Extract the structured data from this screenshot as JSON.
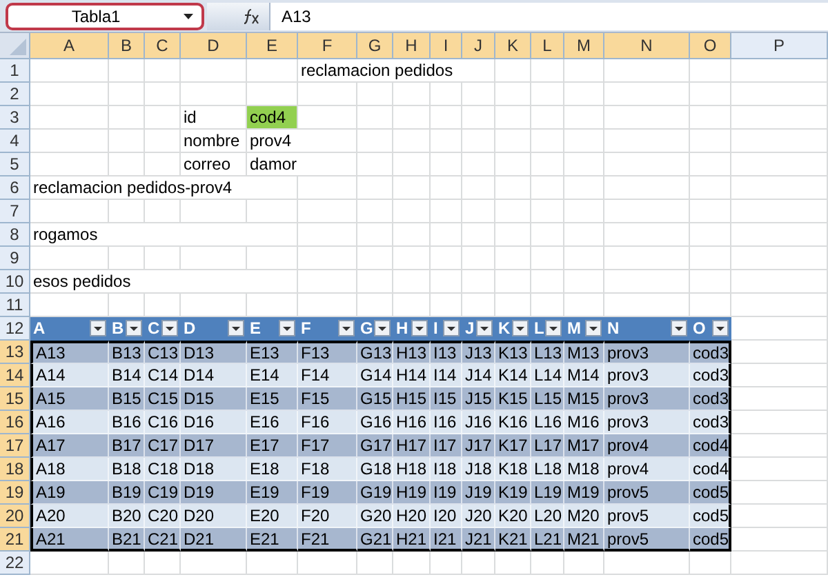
{
  "name_box": {
    "value": "Tabla1"
  },
  "formula_bar": {
    "value": "A13"
  },
  "columns": [
    {
      "label": "A",
      "selected": true
    },
    {
      "label": "B",
      "selected": true
    },
    {
      "label": "C",
      "selected": true
    },
    {
      "label": "D",
      "selected": true
    },
    {
      "label": "E",
      "selected": true
    },
    {
      "label": "F",
      "selected": true
    },
    {
      "label": "G",
      "selected": true
    },
    {
      "label": "H",
      "selected": true
    },
    {
      "label": "I",
      "selected": true
    },
    {
      "label": "J",
      "selected": true
    },
    {
      "label": "K",
      "selected": true
    },
    {
      "label": "L",
      "selected": true
    },
    {
      "label": "M",
      "selected": true
    },
    {
      "label": "N",
      "selected": true
    },
    {
      "label": "O",
      "selected": true
    },
    {
      "label": "P",
      "selected": false
    }
  ],
  "rows": [
    {
      "number": "1",
      "selected": false,
      "kind": "plain",
      "cells": {
        "F": "reclamacion pedidos"
      }
    },
    {
      "number": "2",
      "selected": false,
      "kind": "plain",
      "cells": {}
    },
    {
      "number": "3",
      "selected": false,
      "kind": "plain",
      "cells": {
        "D": "id",
        "E": {
          "text": "cod4",
          "highlighted": true
        }
      }
    },
    {
      "number": "4",
      "selected": false,
      "kind": "plain",
      "cells": {
        "D": "nombre",
        "E": "prov4"
      }
    },
    {
      "number": "5",
      "selected": false,
      "kind": "plain",
      "cells": {
        "D": "correo",
        "E": "damor"
      }
    },
    {
      "number": "6",
      "selected": false,
      "kind": "plain",
      "cells": {
        "A": "reclamacion pedidos-prov4"
      }
    },
    {
      "number": "7",
      "selected": false,
      "kind": "plain",
      "cells": {}
    },
    {
      "number": "8",
      "selected": false,
      "kind": "plain",
      "cells": {
        "A": "rogamos"
      }
    },
    {
      "number": "9",
      "selected": false,
      "kind": "plain",
      "cells": {}
    },
    {
      "number": "10",
      "selected": false,
      "kind": "plain",
      "cells": {
        "A": "esos pedidos"
      }
    },
    {
      "number": "11",
      "selected": false,
      "kind": "plain",
      "cells": {}
    },
    {
      "number": "12",
      "selected": false,
      "kind": "table_header",
      "cells": {
        "A": "A",
        "B": "B",
        "C": "C",
        "D": "D",
        "E": "E",
        "F": "F",
        "G": "G",
        "H": "H",
        "I": "I",
        "J": "J",
        "K": "K",
        "L": "L",
        "M": "M",
        "N": "N",
        "O": "O"
      }
    },
    {
      "number": "13",
      "selected": true,
      "kind": "table_body",
      "cells": {
        "A": "A13",
        "B": "B13",
        "C": "C13",
        "D": "D13",
        "E": "E13",
        "F": "F13",
        "G": "G13",
        "H": "H13",
        "I": "I13",
        "J": "J13",
        "K": "K13",
        "L": "L13",
        "M": "M13",
        "N": "prov3",
        "O": "cod3"
      }
    },
    {
      "number": "14",
      "selected": true,
      "kind": "table_body",
      "cells": {
        "A": "A14",
        "B": "B14",
        "C": "C14",
        "D": "D14",
        "E": "E14",
        "F": "F14",
        "G": "G14",
        "H": "H14",
        "I": "I14",
        "J": "J14",
        "K": "K14",
        "L": "L14",
        "M": "M14",
        "N": "prov3",
        "O": "cod3"
      }
    },
    {
      "number": "15",
      "selected": true,
      "kind": "table_body",
      "cells": {
        "A": "A15",
        "B": "B15",
        "C": "C15",
        "D": "D15",
        "E": "E15",
        "F": "F15",
        "G": "G15",
        "H": "H15",
        "I": "I15",
        "J": "J15",
        "K": "K15",
        "L": "L15",
        "M": "M15",
        "N": "prov3",
        "O": "cod3"
      }
    },
    {
      "number": "16",
      "selected": true,
      "kind": "table_body",
      "cells": {
        "A": "A16",
        "B": "B16",
        "C": "C16",
        "D": "D16",
        "E": "E16",
        "F": "F16",
        "G": "G16",
        "H": "H16",
        "I": "I16",
        "J": "J16",
        "K": "K16",
        "L": "L16",
        "M": "M16",
        "N": "prov3",
        "O": "cod3"
      }
    },
    {
      "number": "17",
      "selected": true,
      "kind": "table_body",
      "cells": {
        "A": "A17",
        "B": "B17",
        "C": "C17",
        "D": "D17",
        "E": "E17",
        "F": "F17",
        "G": "G17",
        "H": "H17",
        "I": "I17",
        "J": "J17",
        "K": "K17",
        "L": "L17",
        "M": "M17",
        "N": "prov4",
        "O": "cod4"
      }
    },
    {
      "number": "18",
      "selected": true,
      "kind": "table_body",
      "cells": {
        "A": "A18",
        "B": "B18",
        "C": "C18",
        "D": "D18",
        "E": "E18",
        "F": "F18",
        "G": "G18",
        "H": "H18",
        "I": "I18",
        "J": "J18",
        "K": "K18",
        "L": "L18",
        "M": "M18",
        "N": "prov4",
        "O": "cod4"
      }
    },
    {
      "number": "19",
      "selected": true,
      "kind": "table_body",
      "cells": {
        "A": "A19",
        "B": "B19",
        "C": "C19",
        "D": "D19",
        "E": "E19",
        "F": "F19",
        "G": "G19",
        "H": "H19",
        "I": "I19",
        "J": "J19",
        "K": "K19",
        "L": "L19",
        "M": "M19",
        "N": "prov5",
        "O": "cod5"
      }
    },
    {
      "number": "20",
      "selected": true,
      "kind": "table_body",
      "cells": {
        "A": "A20",
        "B": "B20",
        "C": "C20",
        "D": "D20",
        "E": "E20",
        "F": "F20",
        "G": "G20",
        "H": "H20",
        "I": "I20",
        "J": "J20",
        "K": "K20",
        "L": "L20",
        "M": "M20",
        "N": "prov5",
        "O": "cod5"
      }
    },
    {
      "number": "21",
      "selected": true,
      "kind": "table_body",
      "cells": {
        "A": "A21",
        "B": "B21",
        "C": "C21",
        "D": "D21",
        "E": "E21",
        "F": "F21",
        "G": "G21",
        "H": "H21",
        "I": "I21",
        "J": "J21",
        "K": "K21",
        "L": "L21",
        "M": "M21",
        "N": "prov5",
        "O": "cod5"
      }
    },
    {
      "number": "22",
      "selected": false,
      "kind": "plain",
      "cells": {}
    }
  ]
}
